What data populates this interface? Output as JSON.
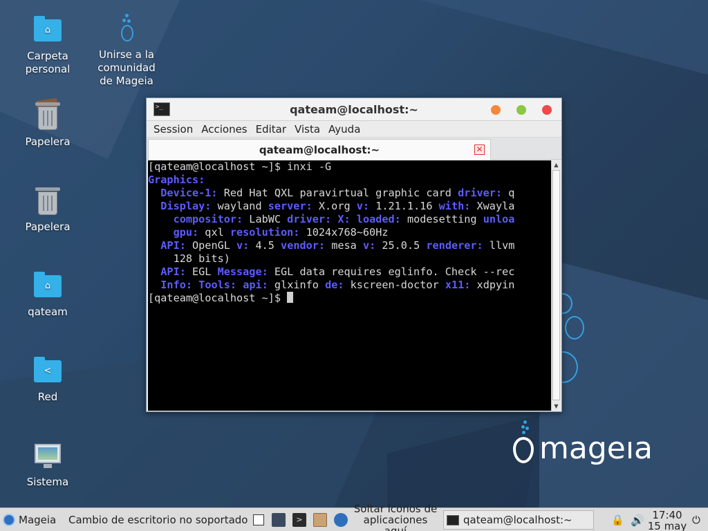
{
  "desktop": {
    "icons": [
      {
        "label": "Carpeta\npersonal",
        "icon": "home-folder-icon"
      },
      {
        "label": "Unirse a la\ncomunidad\nde Mageia",
        "icon": "mageia-community-icon"
      },
      {
        "label": "Papelera",
        "icon": "trash-full-icon"
      },
      {
        "label": "Papelera",
        "icon": "trash-icon"
      },
      {
        "label": "qateam",
        "icon": "home-folder-icon"
      },
      {
        "label": "Red",
        "icon": "network-folder-icon"
      },
      {
        "label": "Sistema",
        "icon": "computer-icon"
      }
    ],
    "logo_text": "mageıa"
  },
  "window": {
    "title": "qateam@localhost:~",
    "menu": [
      "Session",
      "Acciones",
      "Editar",
      "Vista",
      "Ayuda"
    ],
    "tab_title": "qateam@localhost:~",
    "terminal_lines": [
      [
        {
          "t": "[qateam@localhost ~]$ inxi -G",
          "k": false
        }
      ],
      [
        {
          "t": "Graphics:",
          "k": true
        }
      ],
      [
        {
          "t": "  Device-1:",
          "k": true
        },
        {
          "t": " Red Hat QXL paravirtual graphic card ",
          "k": false
        },
        {
          "t": "driver:",
          "k": true
        },
        {
          "t": " q",
          "k": false
        }
      ],
      [
        {
          "t": "  Display:",
          "k": true
        },
        {
          "t": " wayland ",
          "k": false
        },
        {
          "t": "server:",
          "k": true
        },
        {
          "t": " X.org ",
          "k": false
        },
        {
          "t": "v:",
          "k": true
        },
        {
          "t": " 1.21.1.16 ",
          "k": false
        },
        {
          "t": "with:",
          "k": true
        },
        {
          "t": " Xwayla",
          "k": false
        }
      ],
      [
        {
          "t": "    compositor:",
          "k": true
        },
        {
          "t": " LabWC ",
          "k": false
        },
        {
          "t": "driver:",
          "k": true
        },
        {
          "t": " ",
          "k": false
        },
        {
          "t": "X:",
          "k": true
        },
        {
          "t": " ",
          "k": false
        },
        {
          "t": "loaded:",
          "k": true
        },
        {
          "t": " modesetting ",
          "k": false
        },
        {
          "t": "unloa",
          "k": true
        }
      ],
      [
        {
          "t": "    gpu:",
          "k": true
        },
        {
          "t": " qxl ",
          "k": false
        },
        {
          "t": "resolution:",
          "k": true
        },
        {
          "t": " 1024x768~60Hz",
          "k": false
        }
      ],
      [
        {
          "t": "  API:",
          "k": true
        },
        {
          "t": " OpenGL ",
          "k": false
        },
        {
          "t": "v:",
          "k": true
        },
        {
          "t": " 4.5 ",
          "k": false
        },
        {
          "t": "vendor:",
          "k": true
        },
        {
          "t": " mesa ",
          "k": false
        },
        {
          "t": "v:",
          "k": true
        },
        {
          "t": " 25.0.5 ",
          "k": false
        },
        {
          "t": "renderer:",
          "k": true
        },
        {
          "t": " llvm",
          "k": false
        }
      ],
      [
        {
          "t": "    128 bits)",
          "k": false
        }
      ],
      [
        {
          "t": "  API:",
          "k": true
        },
        {
          "t": " EGL ",
          "k": false
        },
        {
          "t": "Message:",
          "k": true
        },
        {
          "t": " EGL data requires eglinfo. Check --rec",
          "k": false
        }
      ],
      [
        {
          "t": "  Info:",
          "k": true
        },
        {
          "t": " ",
          "k": false
        },
        {
          "t": "Tools:",
          "k": true
        },
        {
          "t": " ",
          "k": false
        },
        {
          "t": "api:",
          "k": true
        },
        {
          "t": " glxinfo ",
          "k": false
        },
        {
          "t": "de:",
          "k": true
        },
        {
          "t": " kscreen-doctor ",
          "k": false
        },
        {
          "t": "x11:",
          "k": true
        },
        {
          "t": " xdpyin",
          "k": false
        }
      ],
      [
        {
          "t": "[qateam@localhost ~]$ ",
          "k": false
        }
      ]
    ]
  },
  "taskbar": {
    "menu_label": "Mageia",
    "desktop_switch_text": "Cambio de escritorio no soportado",
    "drop_area_text": "Soltar iconos de\naplicaciones aquí",
    "task_label": "qateam@localhost:~",
    "clock_time": "17:40",
    "clock_date": "15 may"
  }
}
